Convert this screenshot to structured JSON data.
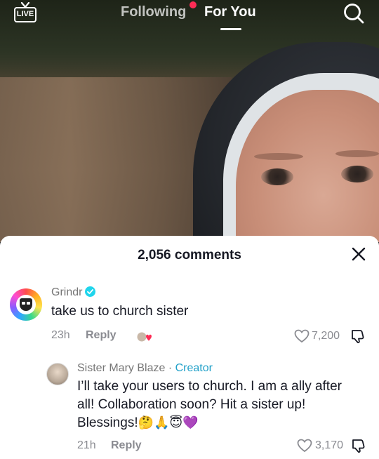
{
  "nav": {
    "live_label": "LIVE",
    "following_label": "Following",
    "for_you_label": "For You"
  },
  "comments_sheet": {
    "title": "2,056 comments"
  },
  "comments": [
    {
      "username": "Grindr",
      "verified": true,
      "text": "take us to church sister",
      "time": "23h",
      "reply_label": "Reply",
      "likes": "7,200"
    },
    {
      "username": "Sister Mary Blaze",
      "creator_separator": "·",
      "creator_label": "Creator",
      "text_line1": "I’ll take your users to church. I am a ally after",
      "text_line2": "all! Collaboration soon? Hit a sister up!",
      "text_line3": "Blessings!",
      "emojis": "🤔🙏😇💜",
      "time": "21h",
      "reply_label": "Reply",
      "likes": "3,170"
    }
  ],
  "colors": {
    "accent_dot": "#fe2c55",
    "verified_badge": "#20d5ec",
    "creator_tag": "#20a0c8"
  }
}
